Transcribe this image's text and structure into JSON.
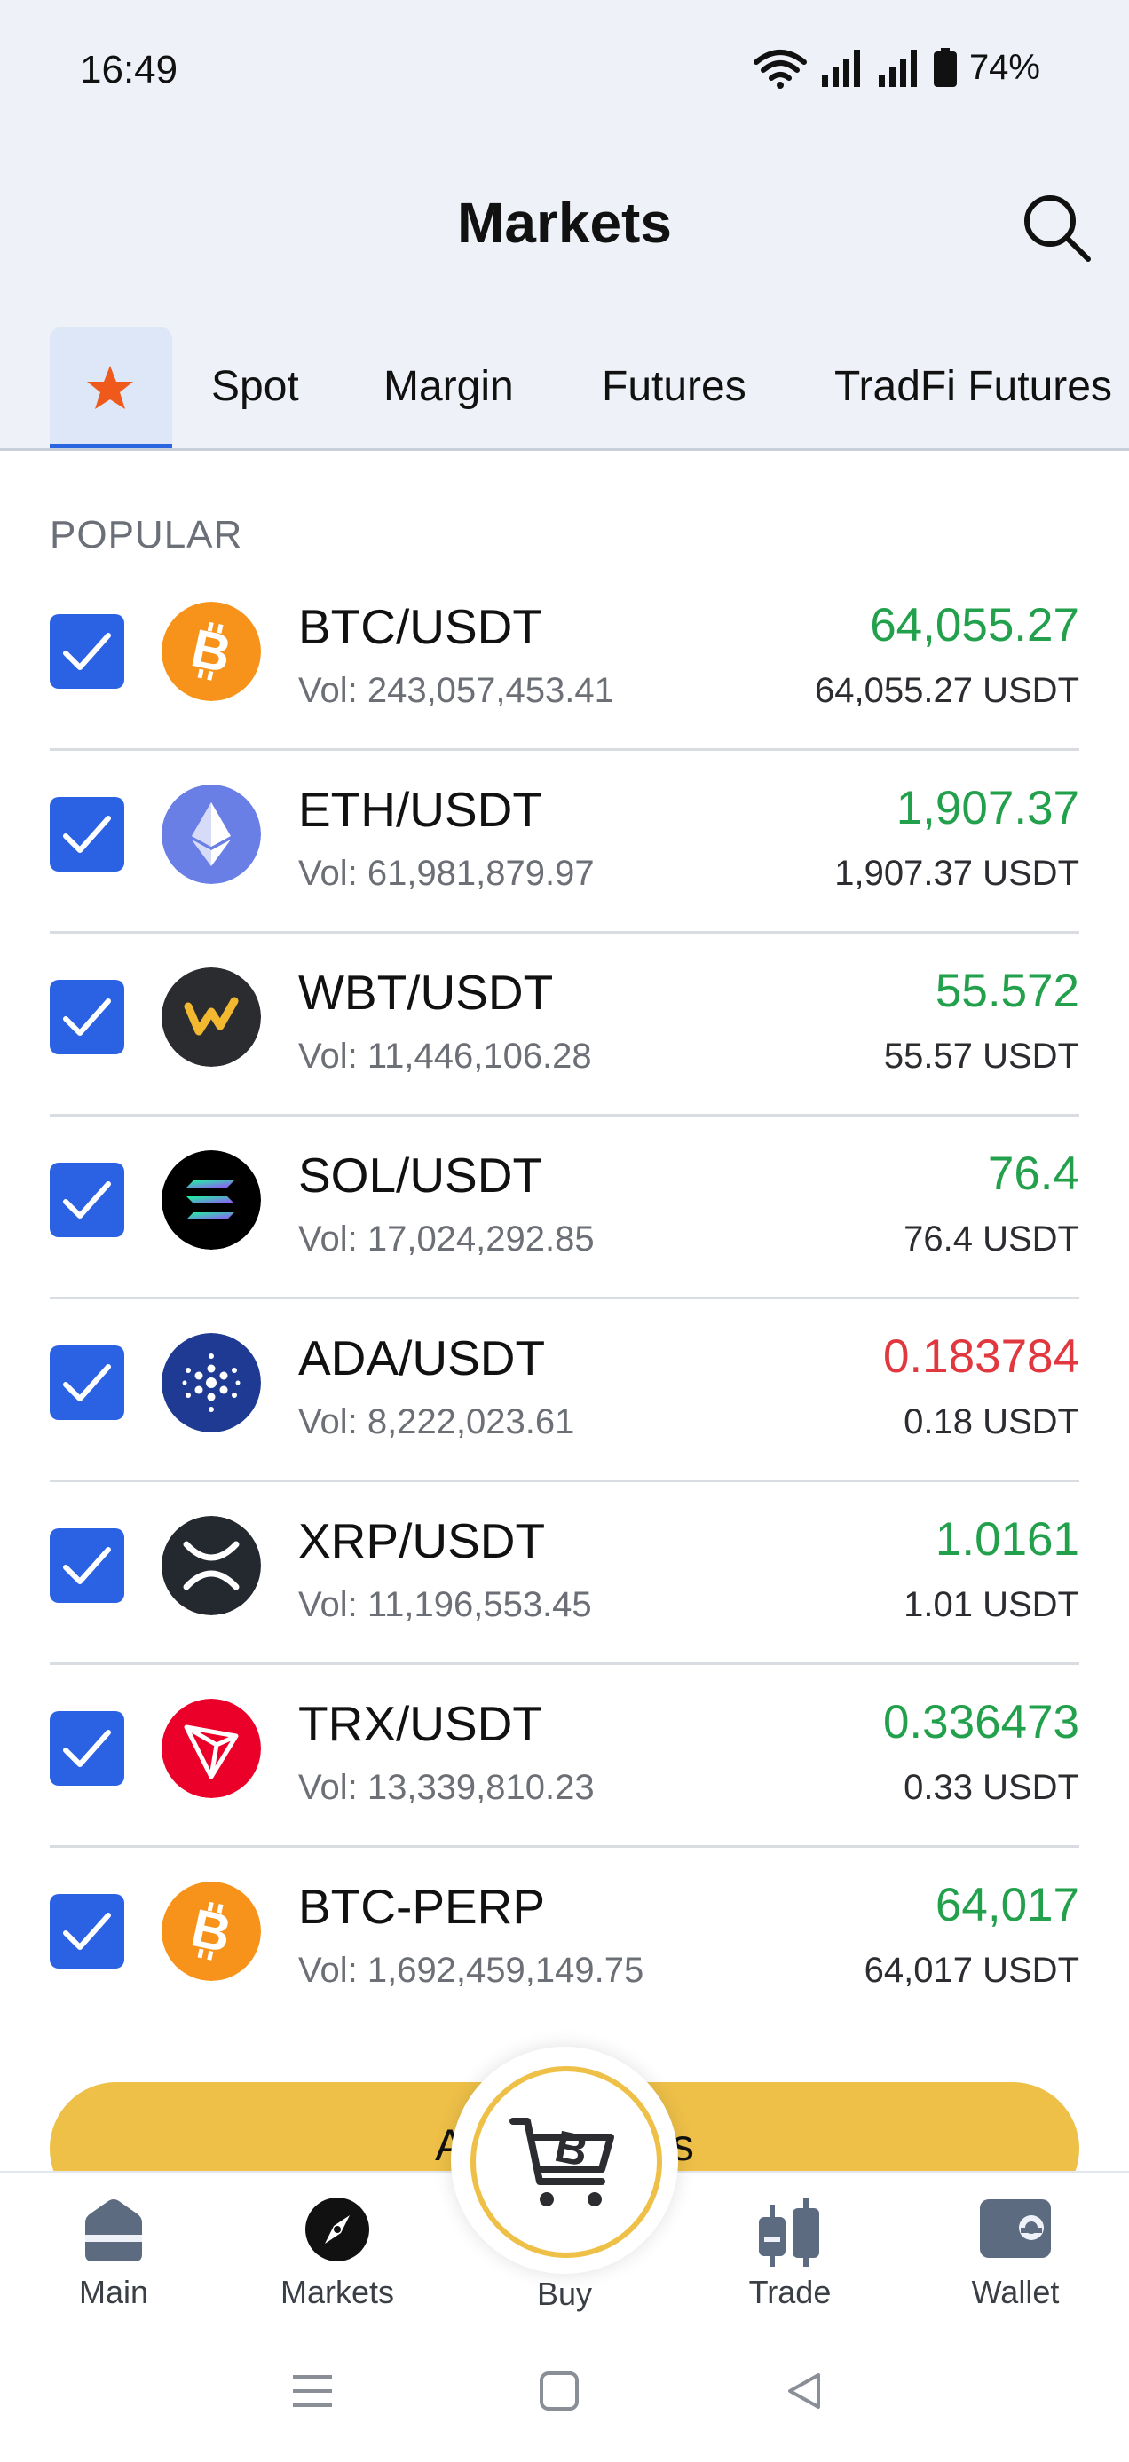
{
  "status": {
    "time": "16:49",
    "battery": "74%"
  },
  "header": {
    "title": "Markets"
  },
  "tabs": [
    "Spot",
    "Margin",
    "Futures",
    "TradFi Futures"
  ],
  "section": {
    "label": "POPULAR"
  },
  "rows": [
    {
      "pair": "BTC/USDT",
      "vol": "Vol: 243,057,453.41",
      "price": "64,055.27",
      "usd": "64,055.27 USDT",
      "trend": "up",
      "icon": "bitcoin-icon"
    },
    {
      "pair": "ETH/USDT",
      "vol": "Vol: 61,981,879.97",
      "price": "1,907.37",
      "usd": "1,907.37 USDT",
      "trend": "up",
      "icon": "ethereum-icon"
    },
    {
      "pair": "WBT/USDT",
      "vol": "Vol: 11,446,106.28",
      "price": "55.572",
      "usd": "55.57 USDT",
      "trend": "up",
      "icon": "whitebit-icon"
    },
    {
      "pair": "SOL/USDT",
      "vol": "Vol: 17,024,292.85",
      "price": "76.4",
      "usd": "76.4 USDT",
      "trend": "up",
      "icon": "solana-icon"
    },
    {
      "pair": "ADA/USDT",
      "vol": "Vol: 8,222,023.61",
      "price": "0.183784",
      "usd": "0.18 USDT",
      "trend": "down",
      "icon": "cardano-icon"
    },
    {
      "pair": "XRP/USDT",
      "vol": "Vol: 11,196,553.45",
      "price": "1.0161",
      "usd": "1.01 USDT",
      "trend": "up",
      "icon": "xrp-icon"
    },
    {
      "pair": "TRX/USDT",
      "vol": "Vol: 13,339,810.23",
      "price": "0.336473",
      "usd": "0.33 USDT",
      "trend": "up",
      "icon": "tron-icon"
    },
    {
      "pair": "BTC-PERP",
      "vol": "Vol: 1,692,459,149.75",
      "price": "64,017",
      "usd": "64,017 USDT",
      "trend": "up",
      "icon": "bitcoin-icon"
    }
  ],
  "add_button": {
    "label": "Add favorites"
  },
  "nav": {
    "main": "Main",
    "markets": "Markets",
    "buy": "Buy",
    "trade": "Trade",
    "wallet": "Wallet"
  },
  "colors": {
    "up": "#22a04b",
    "down": "#e0383e",
    "accent": "#2b62e4",
    "button": "#eec048"
  }
}
